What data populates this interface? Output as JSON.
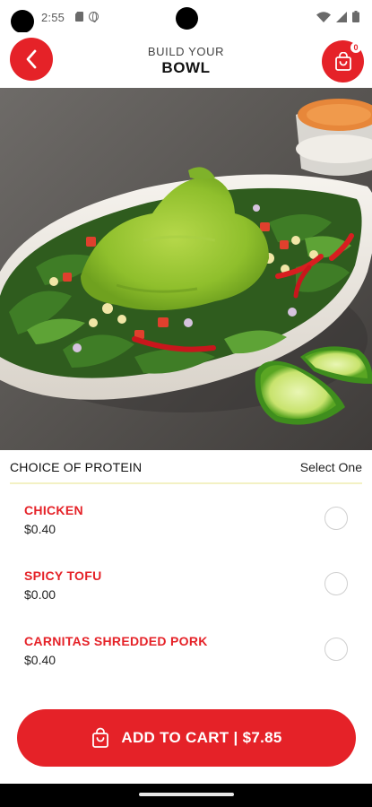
{
  "status_bar": {
    "time": "2:55"
  },
  "header": {
    "subtitle": "BUILD YOUR",
    "title": "BOWL",
    "cart_count": "0"
  },
  "hero": {
    "image": "burrito-bowl-photo"
  },
  "section": {
    "title": "CHOICE OF PROTEIN",
    "hint": "Select One"
  },
  "options": [
    {
      "name": "CHICKEN",
      "price": "$0.40",
      "selected": false
    },
    {
      "name": "SPICY TOFU",
      "price": "$0.00",
      "selected": false
    },
    {
      "name": "CARNITAS SHREDDED PORK",
      "price": "$0.40",
      "selected": false
    }
  ],
  "cta": {
    "label": "ADD TO CART | $7.85"
  },
  "colors": {
    "accent": "#e52228",
    "divider": "#f3f1c4"
  }
}
